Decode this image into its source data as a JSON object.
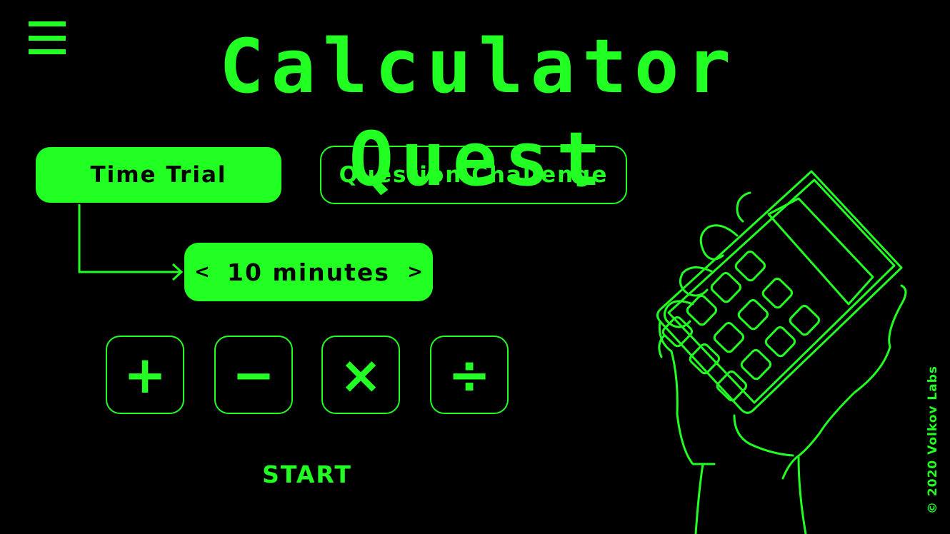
{
  "app": {
    "title": "Calculator Quest",
    "accent_color": "#22ff22",
    "background_color": "#000000"
  },
  "menu": {
    "icon": "hamburger-menu-icon"
  },
  "modes": {
    "time_trial": "Time Trial",
    "question_challenge": "Question Challenge",
    "selected": "Time Trial"
  },
  "duration": {
    "prev": "<",
    "value": "10 minutes",
    "next": ">"
  },
  "operations": [
    {
      "symbol": "+",
      "icon": "plus-icon"
    },
    {
      "symbol": "−",
      "icon": "minus-icon"
    },
    {
      "symbol": "×",
      "icon": "multiply-icon"
    },
    {
      "symbol": "÷",
      "icon": "divide-icon"
    }
  ],
  "start_label": "START",
  "illustration": "hand-holding-calculator",
  "footer": {
    "copyright": "© 2020 Volkov Labs"
  }
}
